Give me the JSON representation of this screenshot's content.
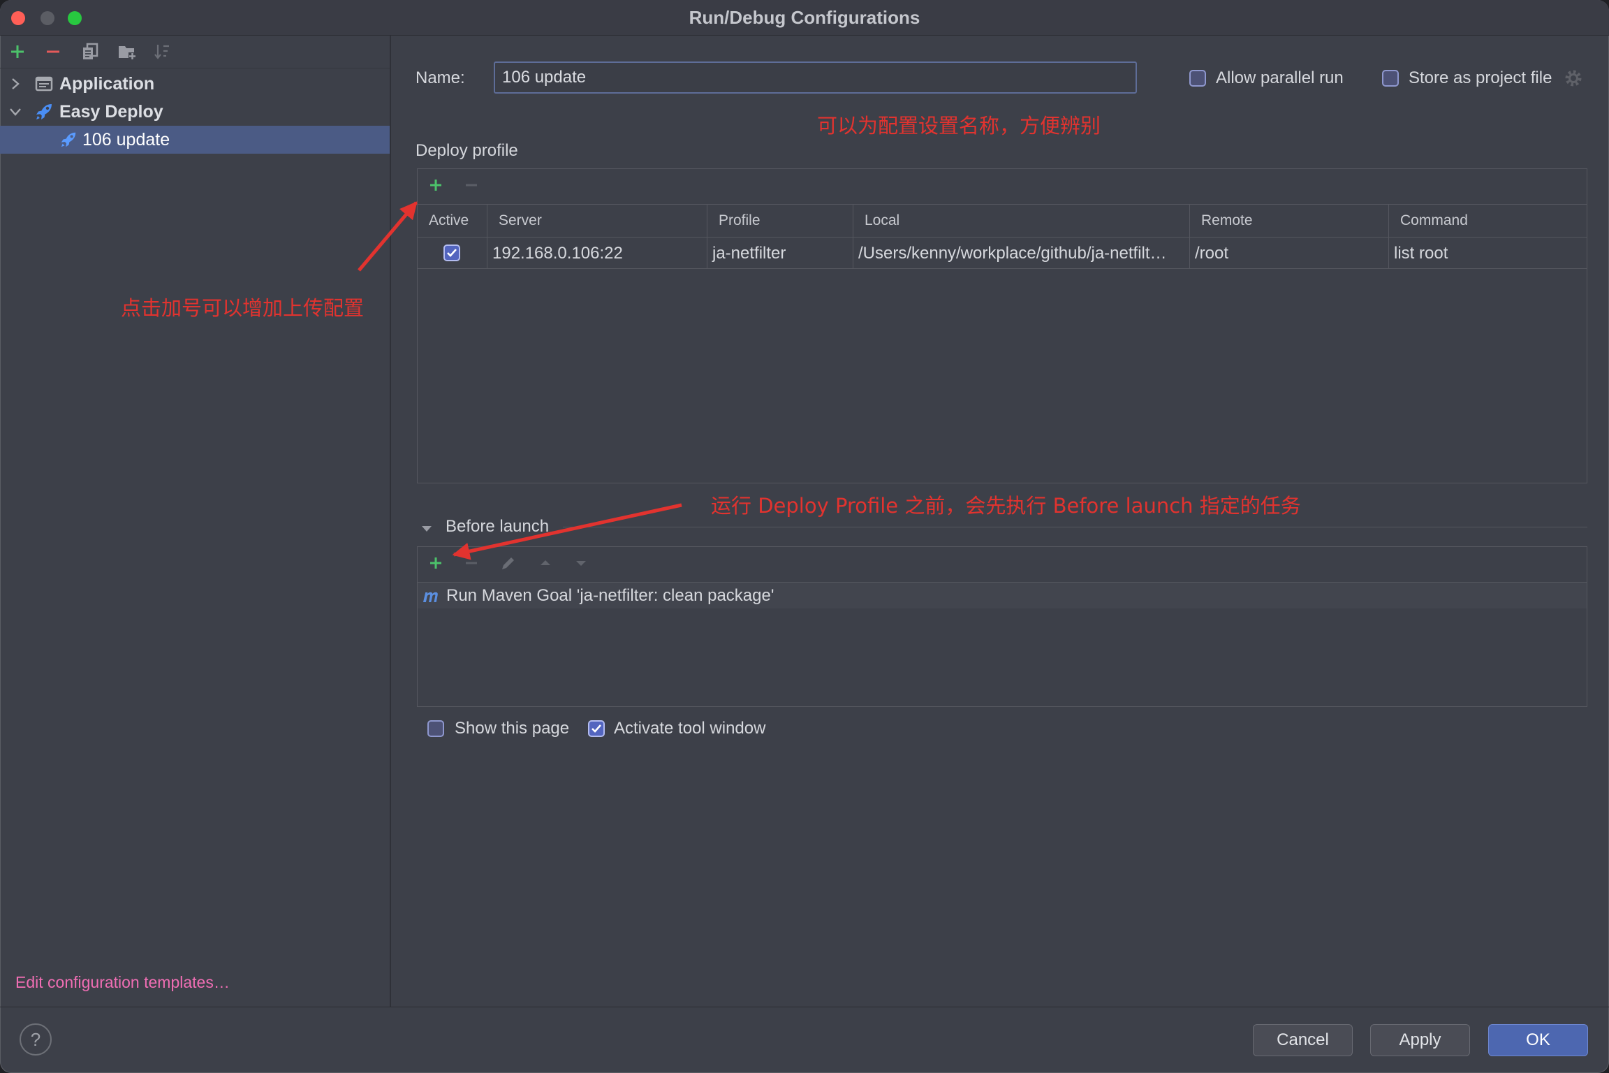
{
  "window": {
    "title": "Run/Debug Configurations"
  },
  "colors": {
    "accent": "#4d67b0",
    "annotation": "#e2332f",
    "link": "#f06eb4",
    "add": "#4cc26a",
    "remove": "#e55a5a",
    "selection": "#4b5b85"
  },
  "sidebar": {
    "toolbar": [
      "add-icon",
      "remove-icon",
      "copy-icon",
      "new-folder-icon",
      "sort-icon"
    ],
    "tree": [
      {
        "label": "Application",
        "icon": "application-icon",
        "expanded": false
      },
      {
        "label": "Easy Deploy",
        "icon": "rocket-icon",
        "expanded": true
      },
      {
        "label": "106 update",
        "icon": "rocket-icon",
        "selected": true
      }
    ],
    "edit_templates_link": "Edit configuration templates…"
  },
  "config": {
    "name_label": "Name:",
    "name_value": "106 update",
    "allow_parallel_run": {
      "label": "Allow parallel run",
      "checked": false
    },
    "store_as_project_file": {
      "label": "Store as project file",
      "checked": false
    },
    "deploy_profile": {
      "title": "Deploy profile",
      "columns": [
        "Active",
        "Server",
        "Profile",
        "Local",
        "Remote",
        "Command"
      ],
      "rows": [
        {
          "active": true,
          "server": "192.168.0.106:22",
          "profile": "ja-netfilter",
          "local": "/Users/kenny/workplace/github/ja-netfilt…",
          "remote": "/root",
          "command": "list root"
        }
      ]
    },
    "before_launch": {
      "title": "Before launch",
      "expanded": true,
      "tasks": [
        {
          "icon": "maven-icon",
          "label": "Run Maven Goal 'ja-netfilter: clean package'"
        }
      ]
    },
    "show_this_page": {
      "label": "Show this page",
      "checked": false
    },
    "activate_tool_window": {
      "label": "Activate tool window",
      "checked": true
    }
  },
  "annotations": {
    "name_hint": "可以为配置设置名称，方便辨别",
    "add_profile_hint": "点击加号可以增加上传配置",
    "before_launch_hint": "运行 Deploy Profile 之前，会先执行 Before launch 指定的任务"
  },
  "footer": {
    "help_label": "?",
    "cancel_label": "Cancel",
    "apply_label": "Apply",
    "ok_label": "OK"
  }
}
